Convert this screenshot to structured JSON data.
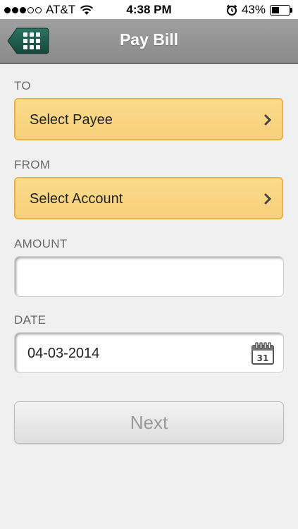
{
  "status_bar": {
    "carrier": "AT&T",
    "time": "4:38 PM",
    "battery": "43%",
    "battery_level": 0.43
  },
  "nav": {
    "title": "Pay Bill",
    "menu_icon": "grid-menu-icon"
  },
  "form": {
    "to_label": "TO",
    "payee_placeholder": "Select Payee",
    "from_label": "FROM",
    "account_placeholder": "Select Account",
    "amount_label": "AMOUNT",
    "amount_value": "",
    "date_label": "DATE",
    "date_value": "04-03-2014",
    "calendar_day": "31",
    "next_label": "Next"
  },
  "colors": {
    "select_fill": "#fbdc8b",
    "select_border": "#e8b24a",
    "nav_bg": "#959595",
    "menu_green": "#1f5a48"
  }
}
